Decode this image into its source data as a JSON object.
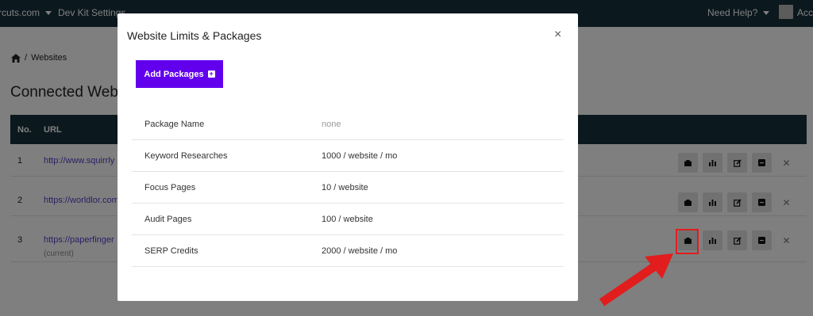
{
  "topnav": {
    "site_label": "rcuts.com",
    "devkit_label": "Dev Kit Settings",
    "help_label": "Need Help?",
    "account_label": "Acco"
  },
  "breadcrumb": {
    "current": "Websites"
  },
  "page": {
    "title": "Connected Websites"
  },
  "table": {
    "headers": {
      "no": "No.",
      "url": "URL"
    },
    "rows": [
      {
        "no": "1",
        "url": "http://www.squirrly",
        "sub": ""
      },
      {
        "no": "2",
        "url": "https://worldlor.com",
        "sub": ""
      },
      {
        "no": "3",
        "url": "https://paperfinger",
        "sub": "(current)"
      }
    ]
  },
  "modal": {
    "title": "Website Limits & Packages",
    "close_label": "×",
    "add_button_label": "Add Packages",
    "add_button_plus": "+",
    "limits": [
      {
        "label": "Package Name",
        "value": "none"
      },
      {
        "label": "Keyword Researches",
        "value": "1000 / website / mo"
      },
      {
        "label": "Focus Pages",
        "value": "10 / website"
      },
      {
        "label": "Audit Pages",
        "value": "100 / website"
      },
      {
        "label": "SERP Credits",
        "value": "2000 / website / mo"
      }
    ]
  },
  "colors": {
    "nav_bg": "#16313d",
    "accent": "#6200ee",
    "link": "#5a3cc9",
    "annotation": "#e11d1d"
  },
  "icons": {
    "row_actions": [
      "package-icon",
      "bar-chart-icon",
      "edit-icon",
      "minus-square-icon",
      "close-icon"
    ]
  }
}
